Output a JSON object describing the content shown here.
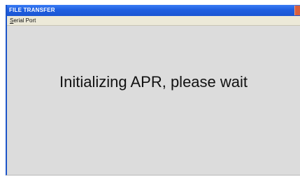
{
  "window": {
    "title": "FILE TRANSFER"
  },
  "menu": {
    "items": [
      {
        "label_accel": "S",
        "label_rest": "erial Port"
      }
    ]
  },
  "main": {
    "message": "Initializing APR, please wait"
  },
  "colors": {
    "titlebar": "#1f5fe0",
    "menubar": "#ece9d8",
    "client_area": "#dcdcdc",
    "close_button": "#d8603e"
  }
}
